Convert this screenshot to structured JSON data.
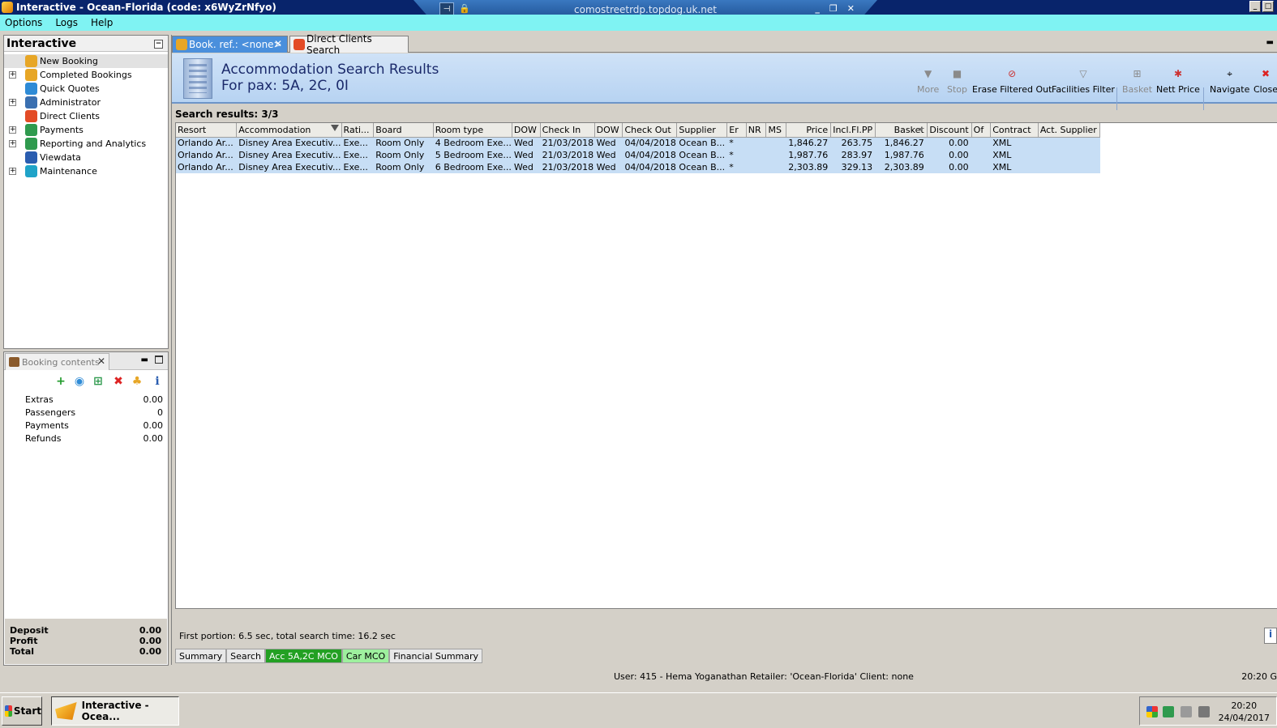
{
  "window": {
    "title": "Interactive - Ocean-Florida (code: x6WyZrNfyo)",
    "rdp_host": "comostreetrdp.topdog.uk.net"
  },
  "menu": [
    "Options",
    "Logs",
    "Help"
  ],
  "nav": {
    "title": "Interactive",
    "items": [
      {
        "label": "New Booking",
        "expandable": false,
        "icon": "palm-tree-icon",
        "color": "#e7a626"
      },
      {
        "label": "Completed Bookings",
        "expandable": true,
        "icon": "palm-tree-icon",
        "color": "#e7a626"
      },
      {
        "label": "Quick Quotes",
        "expandable": false,
        "icon": "quick-quote-icon",
        "color": "#2e8bd6"
      },
      {
        "label": "Administrator",
        "expandable": true,
        "icon": "admin-person-icon",
        "color": "#3a6fb0"
      },
      {
        "label": "Direct Clients",
        "expandable": false,
        "icon": "direct-clients-icon",
        "color": "#e34b26"
      },
      {
        "label": "Payments",
        "expandable": true,
        "icon": "payments-icon",
        "color": "#2f9a4e"
      },
      {
        "label": "Reporting and Analytics",
        "expandable": true,
        "icon": "reporting-icon",
        "color": "#2f9a4e"
      },
      {
        "label": "Viewdata",
        "expandable": false,
        "icon": "viewdata-globe-icon",
        "color": "#2a5db0"
      },
      {
        "label": "Maintenance",
        "expandable": true,
        "icon": "maintenance-box-icon",
        "color": "#1fa3c8"
      }
    ]
  },
  "booking": {
    "tab_label": "Booking contents",
    "rows": [
      {
        "label": "Extras",
        "value": "0.00"
      },
      {
        "label": "Passengers",
        "value": "0"
      },
      {
        "label": "Payments",
        "value": "0.00"
      },
      {
        "label": "Refunds",
        "value": "0.00"
      }
    ],
    "totals": [
      {
        "label": "Deposit",
        "value": "0.00"
      },
      {
        "label": "Profit",
        "value": "0.00"
      },
      {
        "label": "Total",
        "value": "0.00"
      }
    ]
  },
  "tabs": {
    "active": "Book. ref.: <none>",
    "second": "Direct Clients Search"
  },
  "results": {
    "title": "Accommodation Search Results",
    "subtitle": "For pax: 5A, 2C, 0I",
    "count_label": "Search results: 3/3"
  },
  "toolbar": {
    "more": "More",
    "stop": "Stop",
    "erase_filtered": "Erase Filtered Out",
    "facilities_filter": "Facilities Filter",
    "basket": "Basket",
    "nett_price": "Nett Price",
    "navigate": "Navigate",
    "close": "Close"
  },
  "grid": {
    "columns": [
      "Resort",
      "Accommodation",
      "Rati...",
      "Board",
      "Room type",
      "DOW",
      "Check In",
      "DOW",
      "Check Out",
      "Supplier",
      "Er",
      "NR",
      "MS",
      "Price",
      "Incl.Fl.PP",
      "Basket",
      "Discount",
      "Of",
      "Contract",
      "Act. Supplier"
    ],
    "rows": [
      [
        "Orlando Ar...",
        "Disney Area Executiv...",
        "Exe...",
        "Room Only",
        "4 Bedroom Exe...",
        "Wed",
        "21/03/2018",
        "Wed",
        "04/04/2018",
        "Ocean B...",
        "*",
        "",
        "",
        "1,846.27",
        "263.75",
        "1,846.27",
        "0.00",
        "",
        "XML",
        ""
      ],
      [
        "Orlando Ar...",
        "Disney Area Executiv...",
        "Exe...",
        "Room Only",
        "5 Bedroom Exe...",
        "Wed",
        "21/03/2018",
        "Wed",
        "04/04/2018",
        "Ocean B...",
        "*",
        "",
        "",
        "1,987.76",
        "283.97",
        "1,987.76",
        "0.00",
        "",
        "XML",
        ""
      ],
      [
        "Orlando Ar...",
        "Disney Area Executiv...",
        "Exe...",
        "Room Only",
        "6 Bedroom Exe...",
        "Wed",
        "21/03/2018",
        "Wed",
        "04/04/2018",
        "Ocean B...",
        "*",
        "",
        "",
        "2,303.89",
        "329.13",
        "2,303.89",
        "0.00",
        "",
        "XML",
        ""
      ]
    ]
  },
  "timing_text": "First portion: 6.5 sec, total search time: 16.2 sec",
  "bottom_tabs": [
    {
      "label": "Summary",
      "style": "plain"
    },
    {
      "label": "Search",
      "style": "plain"
    },
    {
      "label": "Acc 5A,2C MCO",
      "style": "green"
    },
    {
      "label": "Car MCO",
      "style": "lightgreen"
    },
    {
      "label": "Financial Summary",
      "style": "plain"
    }
  ],
  "status": {
    "text": "User: 415 - Hema Yoganathan   Retailer: 'Ocean-Florida'   Client: none",
    "clock": "20:20 G"
  },
  "taskbar": {
    "start": "Start",
    "task": "Interactive - Ocea...",
    "time": "20:20",
    "date": "24/04/2017"
  }
}
